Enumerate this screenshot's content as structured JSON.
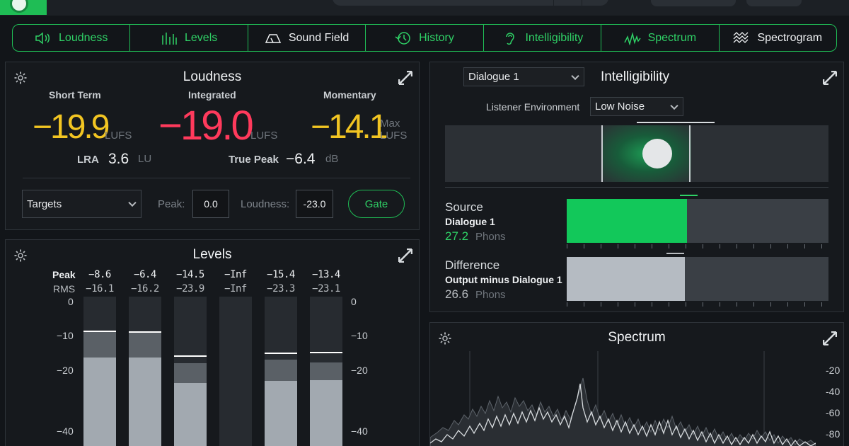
{
  "tabs": [
    {
      "label": "Loudness",
      "icon": "speaker-icon"
    },
    {
      "label": "Levels",
      "icon": "level-bars-icon"
    },
    {
      "label": "Sound Field",
      "icon": "sound-field-icon"
    },
    {
      "label": "History",
      "icon": "history-icon"
    },
    {
      "label": "Intelligibility",
      "icon": "ear-icon"
    },
    {
      "label": "Spectrum",
      "icon": "spectrum-icon"
    },
    {
      "label": "Spectrogram",
      "icon": "spectrogram-icon"
    }
  ],
  "loudness": {
    "title": "Loudness",
    "short_term": {
      "label": "Short Term",
      "value": "−19.9",
      "unit": "LUFS",
      "color": "#f2c522"
    },
    "integrated": {
      "label": "Integrated",
      "value": "−19.0",
      "unit": "LUFS",
      "color": "#ff3a5c"
    },
    "momentary": {
      "label": "Momentary",
      "value": "−14.1",
      "unit1": "Max",
      "unit2": "LUFS",
      "color": "#f2c522"
    },
    "lra": {
      "label": "LRA",
      "value": "3.6",
      "unit": "LU"
    },
    "true_peak": {
      "label": "True Peak",
      "value": "−6.4",
      "unit": "dB"
    },
    "targets": {
      "selected": "Targets"
    },
    "peak": {
      "label": "Peak:",
      "value": "0.0"
    },
    "loudness_target": {
      "label": "Loudness:",
      "value": "-23.0"
    },
    "gate_label": "Gate"
  },
  "levels": {
    "title": "Levels",
    "peak_label": "Peak",
    "rms_label": "RMS",
    "channels": [
      {
        "peak": "−8.6",
        "rms": "−16.1",
        "peak_db": -8.6,
        "rms_db": -16.1,
        "hold_db": -8.6
      },
      {
        "peak": "−6.4",
        "rms": "−16.2",
        "peak_db": -8.8,
        "rms_db": -16.2,
        "hold_db": -8.8
      },
      {
        "peak": "−14.5",
        "rms": "−23.9",
        "peak_db": -17.8,
        "rms_db": -23.9,
        "hold_db": -15.7
      },
      {
        "peak": "−Inf",
        "rms": "−Inf",
        "peak_db": null,
        "rms_db": null,
        "hold_db": null
      },
      {
        "peak": "−15.4",
        "rms": "−23.3",
        "peak_db": -16.8,
        "rms_db": -23.3,
        "hold_db": -14.9
      },
      {
        "peak": "−13.4",
        "rms": "−23.1",
        "peak_db": -17.6,
        "rms_db": -23.1,
        "hold_db": -14.7
      }
    ],
    "scale": [
      "0",
      "−10",
      "−20",
      "−40"
    ]
  },
  "intelligibility": {
    "title": "Intelligibility",
    "track_select": "Dialogue 1",
    "listener_env_label": "Listener Environment",
    "listener_env_value": "Low Noise",
    "source": {
      "label": "Source",
      "name": "Dialogue 1",
      "value": "27.2",
      "unit": "Phons",
      "fill": 0.46
    },
    "difference": {
      "label": "Difference",
      "name": "Output minus Dialogue 1",
      "value": "26.6",
      "unit": "Phons",
      "fill": 0.45
    }
  },
  "spectrum": {
    "title": "Spectrum",
    "scale": [
      "-20",
      "-40",
      "-60",
      "-80"
    ]
  },
  "colors": {
    "accent": "#1fbd55",
    "source_bar": "#12c85a",
    "difference_bar": "#b5bbc2"
  }
}
